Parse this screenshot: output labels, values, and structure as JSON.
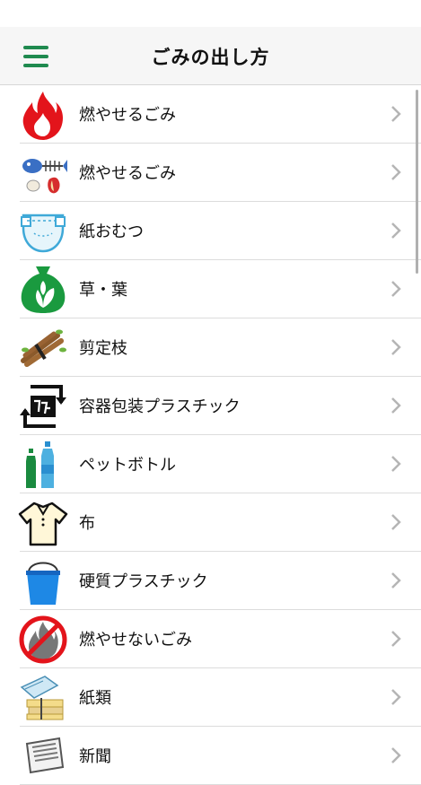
{
  "nav": {
    "title": "ごみの出し方"
  },
  "items": [
    {
      "label": "燃やせるごみ",
      "icon": "flame-icon"
    },
    {
      "label": "燃やせるごみ",
      "icon": "fish-bones-icon"
    },
    {
      "label": "紙おむつ",
      "icon": "diaper-icon"
    },
    {
      "label": "草・葉",
      "icon": "leaf-bag-icon"
    },
    {
      "label": "剪定枝",
      "icon": "branches-icon"
    },
    {
      "label": "容器包装プラスチック",
      "icon": "plastic-recycle-icon"
    },
    {
      "label": "ペットボトル",
      "icon": "pet-bottle-icon"
    },
    {
      "label": "布",
      "icon": "shirt-icon"
    },
    {
      "label": "硬質プラスチック",
      "icon": "bucket-icon"
    },
    {
      "label": "燃やせないごみ",
      "icon": "no-burn-icon"
    },
    {
      "label": "紙類",
      "icon": "paper-bundle-icon"
    },
    {
      "label": "新聞",
      "icon": "newspaper-icon"
    }
  ]
}
